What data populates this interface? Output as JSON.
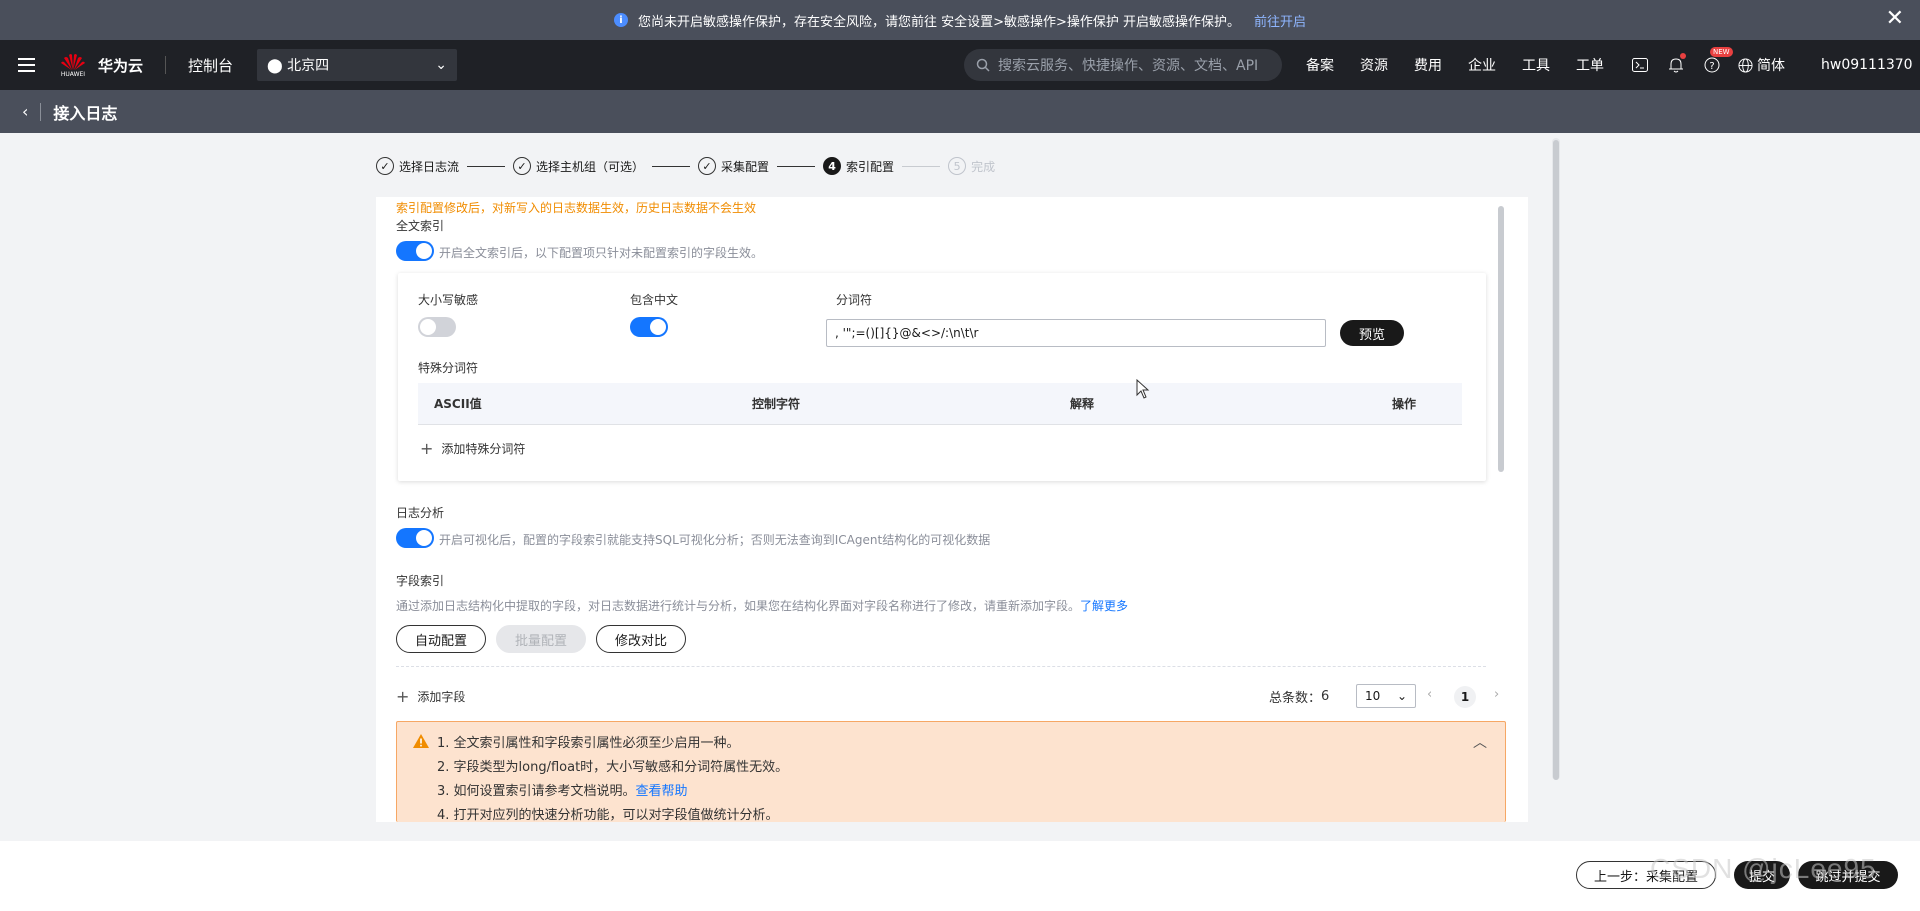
{
  "notice": {
    "text": "您尚未开启敏感操作保护，存在安全风险，请您前往 安全设置>敏感操作>操作保护 开启敏感操作保护。",
    "link": "前往开启"
  },
  "topbar": {
    "logo_sub": "HUAWEI",
    "brand": "华为云",
    "console": "控制台",
    "region": "北京四",
    "search_placeholder": "搜索云服务、快捷操作、资源、文档、API",
    "links": [
      "备案",
      "资源",
      "费用",
      "企业",
      "工具",
      "工单"
    ],
    "new_badge": "NEW",
    "lang": "简体",
    "user": "hw09111370"
  },
  "subbar": {
    "title": "接入日志"
  },
  "steps": [
    {
      "label": "选择日志流",
      "state": "done"
    },
    {
      "label": "选择主机组（可选）",
      "state": "done"
    },
    {
      "label": "采集配置",
      "state": "done"
    },
    {
      "label": "索引配置",
      "state": "active",
      "num": "4"
    },
    {
      "label": "完成",
      "state": "todo",
      "num": "5"
    }
  ],
  "index": {
    "warning": "索引配置修改后，对新写入的日志数据生效，历史日志数据不会生效",
    "fulltext_label": "全文索引",
    "fulltext_on": true,
    "fulltext_hint": "开启全文索引后，以下配置项只针对未配置索引的字段生效。",
    "case_label": "大小写敏感",
    "case_on": false,
    "chinese_label": "包含中文",
    "chinese_on": true,
    "delim_label": "分词符",
    "delim_value": ", '\";=()[]{}@&<>/:\\n\\t\\r",
    "preview": "预览",
    "special_label": "特殊分词符",
    "cols": [
      "ASCII值",
      "控制字符",
      "解释",
      "操作"
    ],
    "add_special": "添加特殊分词符",
    "analysis_label": "日志分析",
    "analysis_on": true,
    "analysis_hint": "开启可视化后，配置的字段索引就能支持SQL可视化分析；否则无法查询到ICAgent结构化的可视化数据",
    "field_label": "字段索引",
    "field_hint": "通过添加日志结构化中提取的字段，对日志数据进行统计与分析，如果您在结构化界面对字段名称进行了修改，请重新添加字段。",
    "learn_more": "了解更多",
    "btn_auto": "自动配置",
    "btn_batch": "批量配置",
    "btn_compare": "修改对比",
    "add_field": "添加字段",
    "total_label": "总条数：",
    "total": "6",
    "page_size": "10",
    "page": "1"
  },
  "alert": {
    "l1": "1. 全文索引属性和字段索引属性必须至少启用一种。",
    "l2": "2. 字段类型为long/float时，大小写敏感和分词符属性无效。",
    "l3": "3. 如何设置索引请参考文档说明。",
    "l3_link": "查看帮助",
    "l4": "4. 打开对应列的快速分析功能，可以对字段值做统计分析。"
  },
  "footer": {
    "prev": "上一步：采集配置",
    "submit": "提交",
    "skip": "跳过并提交",
    "watermark": "CSDN @jcLee95"
  }
}
